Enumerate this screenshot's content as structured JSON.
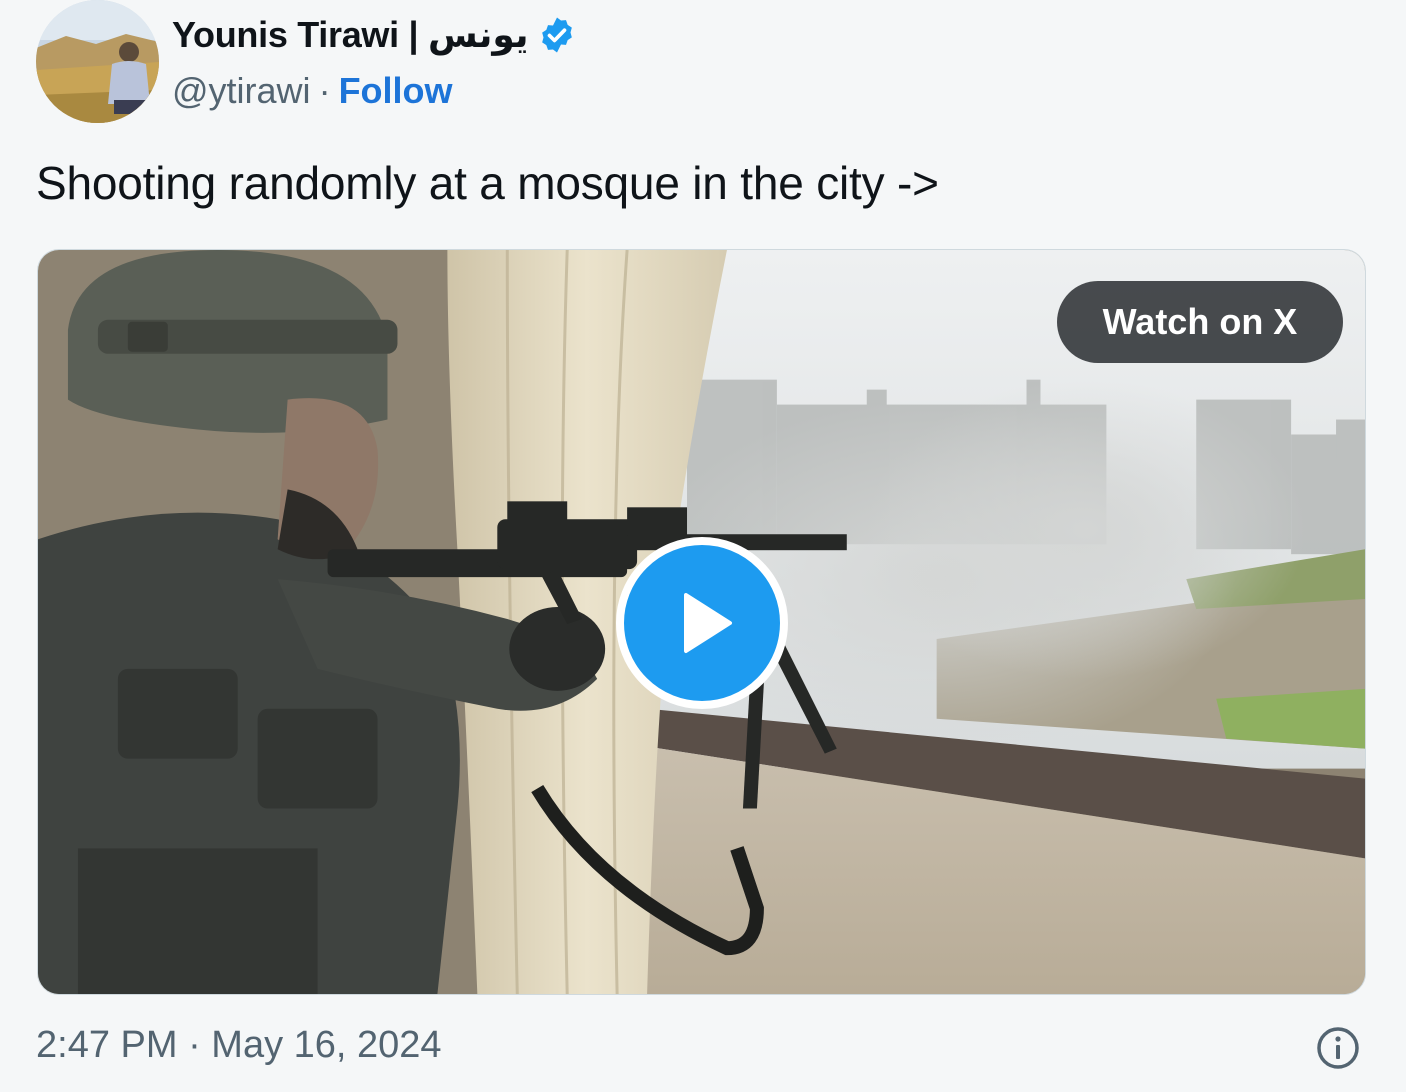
{
  "author": {
    "display_name": "Younis Tirawi | يونس",
    "handle": "@ytirawi",
    "separator": "·",
    "follow_label": "Follow",
    "verified": true,
    "avatar_icon": "profile-photo"
  },
  "tweet": {
    "text": "Shooting randomly at a mosque in the city ->",
    "timestamp": "2:47 PM · May 16, 2024"
  },
  "media": {
    "type": "video",
    "watch_label": "Watch on X",
    "play_icon": "play-icon"
  },
  "footer": {
    "info_icon": "info-icon"
  },
  "colors": {
    "background": "#f5f7f8",
    "follow": "#1d74d8",
    "verified": "#1d9bf0",
    "play": "#1d9bf0",
    "secondary_text": "#536471",
    "watch_button": "#222629"
  }
}
